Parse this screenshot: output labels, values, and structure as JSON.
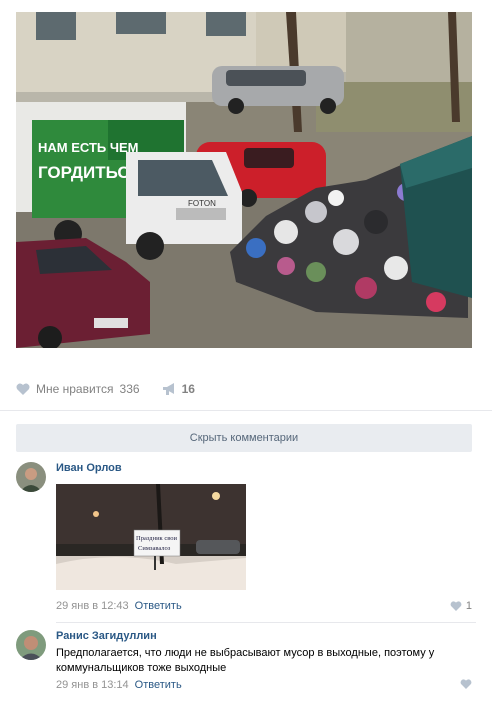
{
  "post": {
    "photo_alt": "",
    "truck_text": "НАМ ЕСТЬ ЧЕМ ГОРДИТЬСЯ!",
    "truck_badge": "FOTON"
  },
  "actions": {
    "like_label": "Мне нравится",
    "like_count": "336",
    "share_count": "16"
  },
  "comments_toggle": "Скрыть комментарии",
  "comments": [
    {
      "author": "Иван Орлов",
      "sign_text": "Праздник свои Cимзавалоз",
      "date": "29 янв в 12:43",
      "reply": "Ответить",
      "likes": "1"
    },
    {
      "author": "Ранис Загидуллин",
      "text": "Предполагается, что люди не выбрасывают мусор в выходные, поэтому у коммунальщиков тоже выходные",
      "date": "29 янв в 13:14",
      "reply": "Ответить",
      "likes": ""
    }
  ],
  "colors": {
    "link": "#2a5885",
    "muted": "#939393",
    "button_bg": "#e9ecf0"
  }
}
